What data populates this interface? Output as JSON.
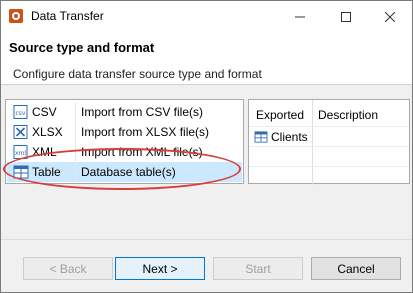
{
  "window": {
    "title": "Data Transfer",
    "controls": {
      "minimize": "—",
      "maximize": "☐",
      "close": "✕"
    }
  },
  "header": {
    "title": "Source type and format",
    "subtitle": "Configure data transfer source type and format"
  },
  "source_types": [
    {
      "icon": "csv-file-icon",
      "name": "CSV",
      "description": "Import from CSV file(s)"
    },
    {
      "icon": "xlsx-file-icon",
      "name": "XLSX",
      "description": "Import from XLSX file(s)"
    },
    {
      "icon": "xml-file-icon",
      "name": "XML",
      "description": "Import from XML file(s)"
    },
    {
      "icon": "table-icon",
      "name": "Table",
      "description": "Database table(s)",
      "selected": true
    }
  ],
  "exported_table": {
    "columns": [
      "Exported",
      "Description"
    ],
    "rows": [
      {
        "icon": "table-icon",
        "name": "Clients"
      }
    ]
  },
  "buttons": {
    "back": "< Back",
    "next": "Next >",
    "start": "Start",
    "cancel": "Cancel"
  },
  "colors": {
    "selection": "#cce8ff",
    "highlight_ellipse": "#d6403c",
    "default_button_border": "#0078d7"
  }
}
